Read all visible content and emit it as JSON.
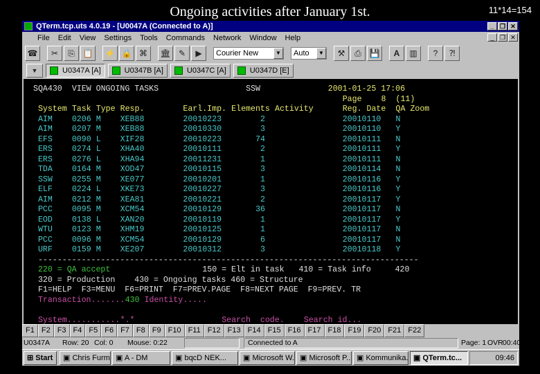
{
  "slide": {
    "title": "Ongoing activities after January 1st.",
    "corner_note": "11*14=154"
  },
  "window": {
    "title": "QTerm.tcp.uts 4.0.19 - [U0047A (Connected to A)]"
  },
  "menu": [
    "File",
    "Edit",
    "View",
    "Settings",
    "Tools",
    "Commands",
    "Network",
    "Window",
    "Help"
  ],
  "toolbar": {
    "font": "Courier New",
    "size": "Auto"
  },
  "sessions": [
    "U0347A [A]",
    "U0347B [A]",
    "U0347C [A]",
    "U0347D [E]"
  ],
  "terminal": {
    "program": "SQA430",
    "screen_title": "VIEW ONGOING TASKS",
    "system": "SSW",
    "datetime": "2001-01-25 17:06",
    "page_label": "Page",
    "page": "8",
    "page_total": "(11)",
    "columns": [
      "System",
      "Task",
      "Type",
      "Resp.",
      "Earl.Imp.",
      "Elements",
      "Activity",
      "Reg. Date",
      "QA",
      "Zoom"
    ],
    "rows": [
      [
        "AIM",
        "0206",
        "M",
        "XEB88",
        "20010223",
        "2",
        "",
        "20010110",
        "N"
      ],
      [
        "AIM",
        "0207",
        "M",
        "XEB88",
        "20010330",
        "3",
        "",
        "20010110",
        "Y"
      ],
      [
        "EFS",
        "0090",
        "L",
        "XIF28",
        "20010223",
        "74",
        "",
        "20010111",
        "N"
      ],
      [
        "ERS",
        "0274",
        "L",
        "XHA40",
        "20010111",
        "2",
        "",
        "20010111",
        "Y"
      ],
      [
        "ERS",
        "0276",
        "L",
        "XHA94",
        "20011231",
        "1",
        "",
        "20010111",
        "N"
      ],
      [
        "TDA",
        "0164",
        "M",
        "XOD47",
        "20010115",
        "3",
        "",
        "20010114",
        "N"
      ],
      [
        "SSW",
        "0255",
        "M",
        "XE077",
        "20010201",
        "1",
        "",
        "20010116",
        "Y"
      ],
      [
        "ELF",
        "0224",
        "L",
        "XKE73",
        "20010227",
        "3",
        "",
        "20010116",
        "Y"
      ],
      [
        "AIM",
        "0212",
        "M",
        "XEA81",
        "20010221",
        "2",
        "",
        "20010117",
        "Y"
      ],
      [
        "PCC",
        "0095",
        "M",
        "XCM54",
        "20010129",
        "36",
        "",
        "20010117",
        "N"
      ],
      [
        "EOD",
        "0138",
        "L",
        "XAN20",
        "20010119",
        "1",
        "",
        "20010117",
        "Y"
      ],
      [
        "WTU",
        "0123",
        "M",
        "XHM19",
        "20010125",
        "1",
        "",
        "20010117",
        "N"
      ],
      [
        "PCC",
        "0096",
        "M",
        "XCM54",
        "20010129",
        "6",
        "",
        "20010117",
        "N"
      ],
      [
        "URF",
        "0159",
        "M",
        "XE207",
        "20010312",
        "3",
        "",
        "20010118",
        "Y"
      ]
    ],
    "separator": "-------------------------------------------------------------------------------",
    "menu1_green": "220 = QA accept",
    "menu1_white": "150 = Elt in task   410 = Task info     420",
    "menu2": "320 = Production    430 = Ongoing tasks 460 = Structure",
    "fkeys_line": "F1=HELP  F3=MENU  F6=PRINT  F7=PREV.PAGE  F8=NEXT PAGE  F9=PREV. TR",
    "transaction_label": "Transaction.......",
    "transaction_value": "430",
    "identity_label": "Identity.....",
    "system_label": "System...........",
    "system_value": "*.*",
    "search_code_label": "Search  code.",
    "search_id_label": "Search id..."
  },
  "fkeys": [
    "F1",
    "F2",
    "F3",
    "F4",
    "F5",
    "F6",
    "F7",
    "F8",
    "F9",
    "F10",
    "F11",
    "F12",
    "F13",
    "F14",
    "F15",
    "F16",
    "F17",
    "F18",
    "F19",
    "F20",
    "F21",
    "F22"
  ],
  "status": {
    "session": "U0347A",
    "row": "Row: 20",
    "col": "Col: 0",
    "mouse": "Mouse:  0:22",
    "connection": "Connected to A",
    "page": "Page: 1",
    "mode": "OVR",
    "time": "00:40"
  },
  "taskbar": {
    "start": "Start",
    "items": [
      "Chris Furme...",
      "A - DM",
      "bqcD NEK...",
      "Microsoft W...",
      "Microsoft P...",
      "Kommunika...",
      "QTerm.tc..."
    ],
    "clock": "09:46"
  },
  "colors": {
    "title_bar": "#000080",
    "header": "#e8e870",
    "data": "#48c8c8",
    "green": "#40c040",
    "magenta": "#c850a8"
  }
}
